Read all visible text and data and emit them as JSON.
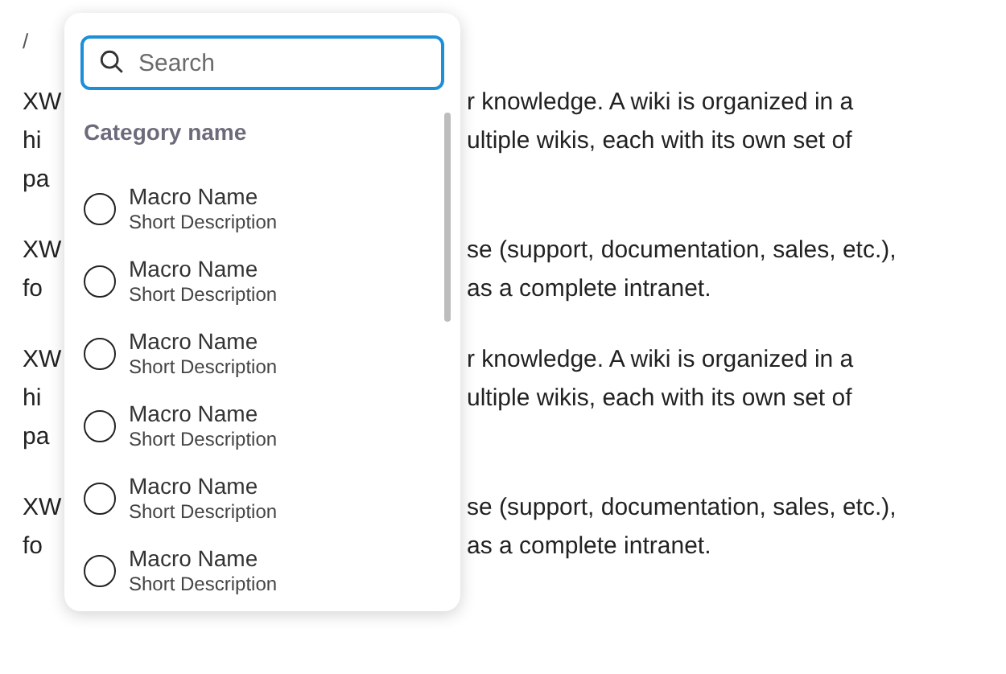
{
  "breadcrumb": "/",
  "paragraphs": [
    {
      "lines": [
        {
          "left": "XW",
          "right": "r knowledge. A wiki is organized in a"
        },
        {
          "left": "hi",
          "right": "ultiple wikis, each with its own set of"
        },
        {
          "left": "pa"
        }
      ]
    },
    {
      "lines": [
        {
          "left": "XW",
          "right": "se (support, documentation, sales, etc.),"
        },
        {
          "left": "fo",
          "right": "as a complete intranet."
        }
      ]
    },
    {
      "lines": [
        {
          "left": "XW",
          "right": "r knowledge. A wiki is organized in a"
        },
        {
          "left": "hi",
          "right": "ultiple wikis, each with its own set of"
        },
        {
          "left": "pa"
        }
      ]
    },
    {
      "lines": [
        {
          "left": "XW",
          "right": "se (support, documentation, sales, etc.),"
        },
        {
          "left": "fo",
          "right": "as a complete intranet."
        }
      ]
    }
  ],
  "popup": {
    "search": {
      "placeholder": "Search"
    },
    "category": "Category name",
    "items": [
      {
        "name": "Macro Name",
        "description": "Short Description",
        "selected": false
      },
      {
        "name": "Macro Name",
        "description": "Short Description",
        "selected": false
      },
      {
        "name": "Macro Name",
        "description": "Short Description",
        "selected": false
      },
      {
        "name": "Macro Name",
        "description": "Short Description",
        "selected": false
      },
      {
        "name": "Macro Name",
        "description": "Short Description",
        "selected": false
      },
      {
        "name": "Macro Name",
        "description": "Short Description",
        "selected": false
      }
    ]
  }
}
